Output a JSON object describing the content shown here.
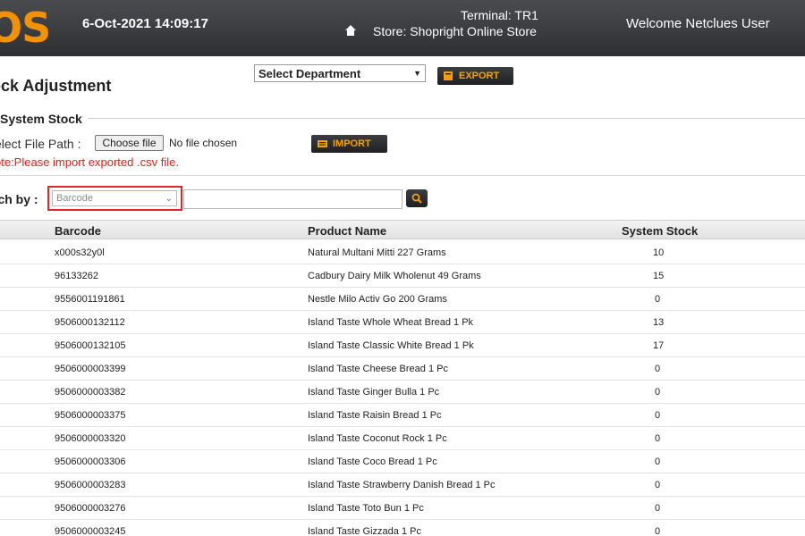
{
  "header": {
    "logo_text": "OS",
    "datetime": "6-Oct-2021 14:09:17",
    "terminal": "Terminal: TR1",
    "store": "Store: Shopright Online Store",
    "welcome": "Welcome Netclues User",
    "icons": {
      "home": "home-icon"
    }
  },
  "toolbar": {
    "department_select": "Select Department",
    "export_label": "EXPORT"
  },
  "page": {
    "title": "ock Adjustment"
  },
  "import_section": {
    "legend": "System Stock",
    "file_label": "elect File Path :",
    "choose_file": "Choose file",
    "file_status": "No file chosen",
    "import_label": "IMPORT",
    "note": "ote:Please import exported .csv file."
  },
  "search": {
    "label": "rch by :",
    "select_value": "Barcode"
  },
  "table": {
    "columns": [
      "Barcode",
      "Product Name",
      "System Stock"
    ],
    "rows": [
      {
        "barcode": "x000s32y0l",
        "name": "Natural Multani Mitti 227 Grams",
        "stock": "10"
      },
      {
        "barcode": "96133262",
        "name": "Cadbury Dairy Milk Wholenut 49 Grams",
        "stock": "15"
      },
      {
        "barcode": "9556001191861",
        "name": "Nestle Milo Activ Go 200 Grams",
        "stock": "0"
      },
      {
        "barcode": "9506000132112",
        "name": "Island Taste Whole Wheat Bread 1 Pk",
        "stock": "13"
      },
      {
        "barcode": "9506000132105",
        "name": "Island Taste Classic White Bread 1 Pk",
        "stock": "17"
      },
      {
        "barcode": "9506000003399",
        "name": "Island Taste Cheese Bread 1 Pc",
        "stock": "0"
      },
      {
        "barcode": "9506000003382",
        "name": "Island Taste Ginger Bulla 1 Pc",
        "stock": "0"
      },
      {
        "barcode": "9506000003375",
        "name": "Island Taste Raisin Bread 1 Pc",
        "stock": "0"
      },
      {
        "barcode": "9506000003320",
        "name": "Island Taste Coconut Rock 1 Pc",
        "stock": "0"
      },
      {
        "barcode": "9506000003306",
        "name": "Island Taste Coco Bread 1 Pc",
        "stock": "0"
      },
      {
        "barcode": "9506000003283",
        "name": "Island Taste Strawberry Danish Bread 1 Pc",
        "stock": "0"
      },
      {
        "barcode": "9506000003276",
        "name": "Island Taste Toto Bun 1 Pc",
        "stock": "0"
      },
      {
        "barcode": "9506000003245",
        "name": "Island Taste Gizzada 1 Pc",
        "stock": "0"
      }
    ]
  },
  "colors": {
    "accent": "#f39200",
    "header_bg": "#3a3c40",
    "note": "#e02020",
    "highlight_border": "#e0262c"
  }
}
